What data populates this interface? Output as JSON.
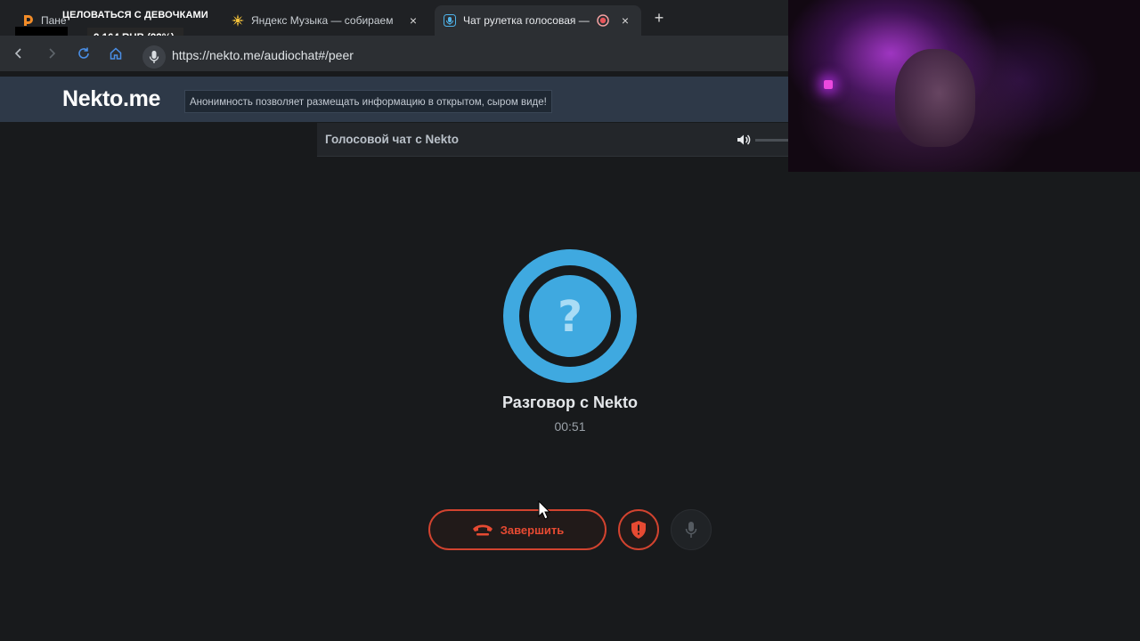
{
  "browser": {
    "tabs": [
      {
        "title": "Пане",
        "favicon": "donationalerts-icon",
        "close": "×"
      },
      {
        "title": "Яндекс Музыка — собираем",
        "favicon": "yandex-music-icon",
        "close": "×"
      },
      {
        "title": "Чат рулетка голосовая —",
        "favicon": "nekto-mic-icon",
        "close": "×",
        "active": true,
        "recording": true
      }
    ],
    "new_tab": "+",
    "url": "https://nekto.me/audiochat#/peer"
  },
  "stream_overlay": {
    "banner": "ЦЕЛОВАТЬСЯ С ДЕВОЧКАМИ",
    "donation_goal": "2 164 RUB (22%)",
    "donation_progress": 0.22
  },
  "site": {
    "logo": "Nekto.me",
    "tagline": "Анонимность позволяет размещать информацию в открытом, сыром виде!",
    "chat_title": "Голосовой чат с Nekto"
  },
  "call": {
    "partner": "Разговор с Nekto",
    "timer": "00:51",
    "avatar_symbol": "?",
    "end_label": "Завершить"
  },
  "colors": {
    "accent_blue": "#3fa9e0",
    "danger_red": "#e64a32",
    "header_bg": "#2e3948"
  }
}
